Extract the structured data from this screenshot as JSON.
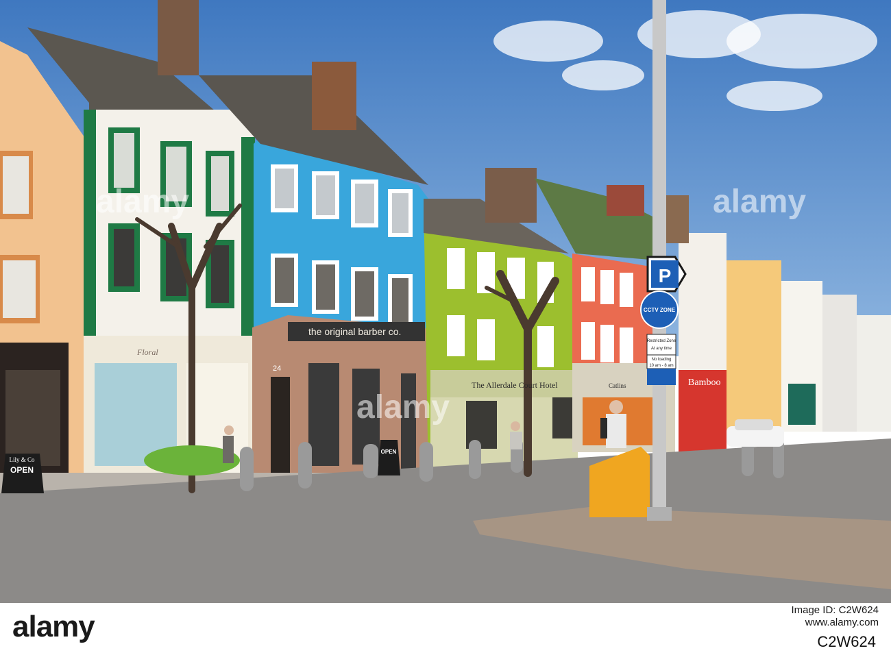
{
  "scene": {
    "signs": {
      "barber": "the original barber co.",
      "floral": "Floral",
      "hotel": "The Allerdale Court Hotel",
      "catlins": "Catlins",
      "bamboo": "Bamboo",
      "shop_sign": "Lily & Co",
      "shop_open": "OPEN",
      "barber_board": "OPEN",
      "parking": "P",
      "cctv": "CCTV ZONE",
      "restricted": "Restricted Zone",
      "restricted_sub": "At any time",
      "no_loading": "No loading",
      "loading_times": "10 am - 8 am",
      "door_number": "24"
    },
    "colors": {
      "sky": "#4f86c6",
      "blue_building": "#39a6dc",
      "green_building": "#9cbf2e",
      "red_building": "#ea6b50",
      "green_trim": "#1f7a45",
      "bollard_yellow": "#f0a620"
    }
  },
  "watermark": {
    "text": "alamy"
  },
  "footer": {
    "logo": "alamy",
    "image_id": "Image ID: C2W624",
    "site": "www.alamy.com",
    "ref": "C2W624"
  }
}
